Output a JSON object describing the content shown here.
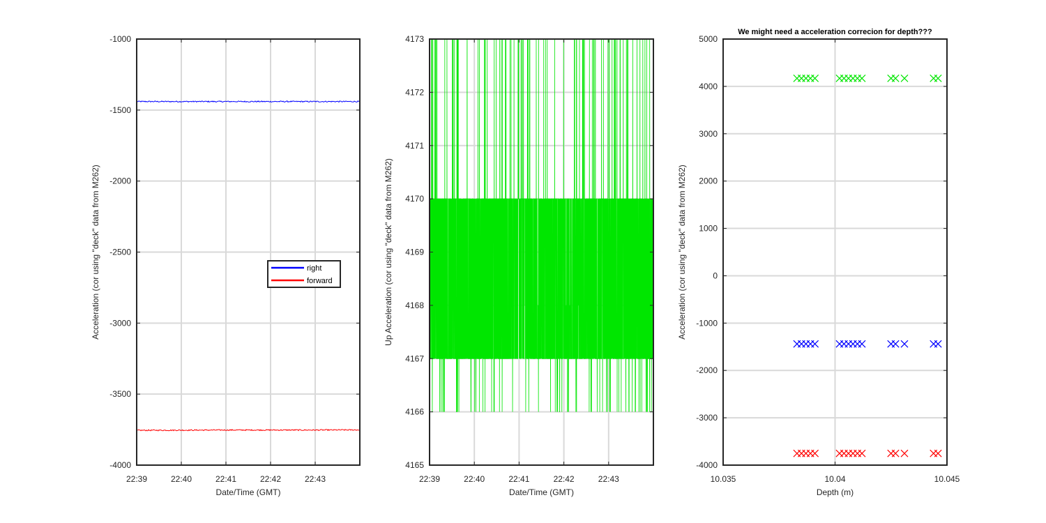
{
  "chart_data": [
    {
      "type": "line",
      "title": "",
      "xlabel": "Date/Time (GMT)",
      "ylabel": "Acceleration (cor using \"deck\" data from M262)",
      "xlim": [
        "22:39",
        "22:44"
      ],
      "ylim": [
        -4000,
        -1000
      ],
      "x_ticks": [
        "22:39",
        "22:40",
        "22:41",
        "22:42",
        "22:43"
      ],
      "y_ticks": [
        "-1000",
        "-1500",
        "-2000",
        "-2500",
        "-3000",
        "-3500",
        "-4000"
      ],
      "grid": true,
      "legend": "center-right",
      "series": [
        {
          "name": "right",
          "color": "#0000ff",
          "x": [
            "22:39",
            "22:41",
            "22:43",
            "22:44"
          ],
          "values": [
            -1440,
            -1440,
            -1440,
            -1440
          ]
        },
        {
          "name": "forward",
          "color": "#ff0000",
          "x": [
            "22:39",
            "22:41",
            "22:43",
            "22:44"
          ],
          "values": [
            -3755,
            -3753,
            -3753,
            -3752
          ]
        }
      ]
    },
    {
      "type": "line",
      "title": "",
      "xlabel": "Date/Time (GMT)",
      "ylabel": "Up Acceleration (cor using \"deck\" data from M262)",
      "xlim": [
        "22:39",
        "22:44"
      ],
      "ylim": [
        4165,
        4173
      ],
      "x_ticks": [
        "22:39",
        "22:40",
        "22:41",
        "22:42",
        "22:43"
      ],
      "y_ticks": [
        "4173",
        "4172",
        "4171",
        "4170",
        "4169",
        "4168",
        "4167",
        "4166",
        "4165"
      ],
      "grid": true,
      "series": [
        {
          "name": "",
          "color": "#00e600",
          "values_range": [
            4166,
            4173
          ],
          "typical_values": [
            4167,
            4170
          ]
        }
      ]
    },
    {
      "type": "scatter",
      "title": "We might need a acceleration correcion for depth???",
      "xlabel": "Depth (m)",
      "ylabel": "Acceleration (cor using \"deck\" data from M262)",
      "xlim": [
        10.035,
        10.045
      ],
      "ylim": [
        -4000,
        5000
      ],
      "x_ticks": [
        "10.035",
        "10.04",
        "10.045"
      ],
      "y_ticks": [
        "5000",
        "4000",
        "3000",
        "2000",
        "1000",
        "0",
        "-1000",
        "-2000",
        "-3000",
        "-4000"
      ],
      "grid": true,
      "marker": "x",
      "depths": [
        10.0383,
        10.0385,
        10.0387,
        10.0389,
        10.0391,
        10.0402,
        10.0404,
        10.0406,
        10.0408,
        10.041,
        10.0412,
        10.0425,
        10.0427,
        10.0431,
        10.0444,
        10.0446
      ],
      "series": [
        {
          "name": "",
          "color": "#00e600",
          "values": [
            4170,
            4170,
            4170,
            4170,
            4170,
            4170,
            4170,
            4170,
            4170,
            4170,
            4170,
            4170,
            4170,
            4170,
            4170,
            4170
          ]
        },
        {
          "name": "",
          "color": "#0000ff",
          "values": [
            -1440,
            -1440,
            -1440,
            -1440,
            -1440,
            -1440,
            -1440,
            -1440,
            -1440,
            -1440,
            -1440,
            -1440,
            -1440,
            -1440,
            -1440,
            -1440
          ]
        },
        {
          "name": "",
          "color": "#ff0000",
          "values": [
            -3753,
            -3753,
            -3753,
            -3753,
            -3753,
            -3753,
            -3753,
            -3753,
            -3753,
            -3753,
            -3753,
            -3753,
            -3753,
            -3753,
            -3753,
            -3753
          ]
        }
      ]
    }
  ]
}
